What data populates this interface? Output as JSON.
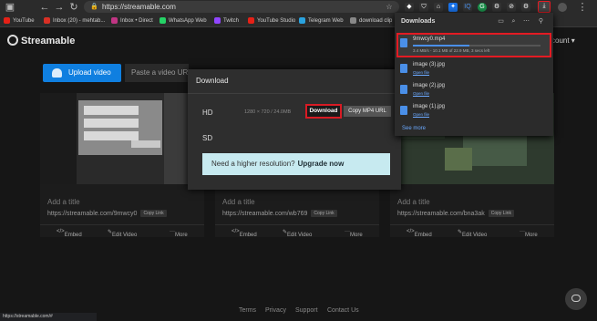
{
  "browser": {
    "url": "https://streamable.com",
    "bookmarks": [
      {
        "label": "YouTube",
        "color": "#e62117"
      },
      {
        "label": "Inbox (20) - mehtab...",
        "color": "#d93025"
      },
      {
        "label": "Inbox • Direct",
        "color": "#c13584"
      },
      {
        "label": "WhatsApp Web",
        "color": "#25d366"
      },
      {
        "label": "Twitch",
        "color": "#9146ff"
      },
      {
        "label": "YouTube Studio",
        "color": "#e62117"
      },
      {
        "label": "Telegram Web",
        "color": "#2aa3df"
      },
      {
        "label": "download clip",
        "color": "#888888"
      }
    ],
    "status_url": "https://streamable.com/#"
  },
  "site": {
    "brand": "Streamable",
    "account_label": "count ▾",
    "upload_label": "Upload video",
    "paste_placeholder": "Paste a video URL"
  },
  "cards": [
    {
      "title": "Add a title",
      "link": "https://streamable.com/9mwcy0",
      "copy": "Copy Link",
      "embed": "Embed",
      "edit": "Edit Video",
      "more": "More"
    },
    {
      "title": "Add a title",
      "link": "https://streamable.com/wb769",
      "copy": "Copy Link",
      "embed": "Embed",
      "edit": "Edit Video",
      "more": "More"
    },
    {
      "title": "Add a title",
      "link": "https://streamable.com/bna3ak",
      "copy": "Copy Link",
      "embed": "Embed",
      "edit": "Edit Video",
      "more": "More"
    }
  ],
  "modal": {
    "title": "Download",
    "hd_label": "HD",
    "hd_info": "1280 × 720 / 24.0MB",
    "download_button": "Download",
    "copy_mp4_button": "Copy MP4 URL",
    "sd_label": "SD",
    "hires_text": "Need a higher resolution?",
    "hires_link": "Upgrade now"
  },
  "downloads_panel": {
    "title": "Downloads",
    "items": [
      {
        "name": "9mwcy0.mp4",
        "status": "3.4 MB/s - 10.1 MB of 22.9 MB, 3 secs left",
        "progress": 0.44
      },
      {
        "name": "image (3).jpg",
        "status": "Open file"
      },
      {
        "name": "image (2).jpg",
        "status": "Open file"
      },
      {
        "name": "image (1).jpg",
        "status": "Open file"
      }
    ],
    "see_more": "See more"
  },
  "footer": {
    "links": [
      "Terms",
      "Privacy",
      "Support",
      "Contact Us"
    ]
  }
}
